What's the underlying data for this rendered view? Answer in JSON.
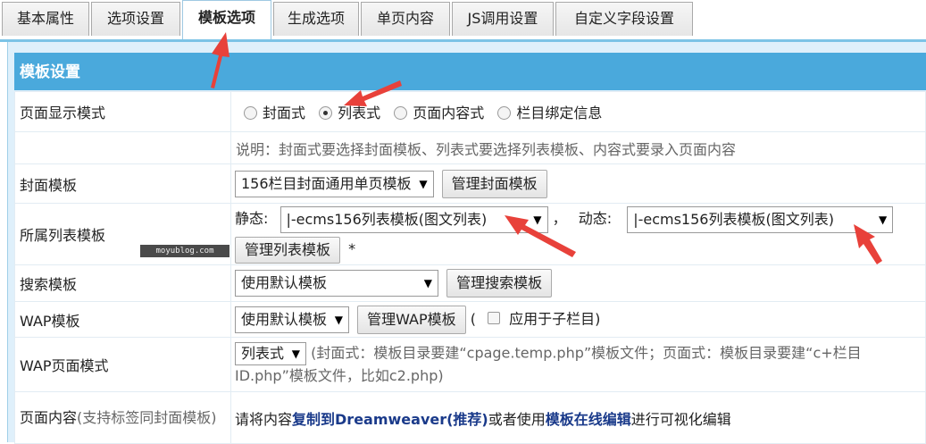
{
  "tabs": [
    "基本属性",
    "选项设置",
    "模板选项",
    "生成选项",
    "单页内容",
    "JS调用设置",
    "自定义字段设置"
  ],
  "panel_title": "模板设置",
  "display_mode": {
    "label": "页面显示模式",
    "options": [
      "封面式",
      "列表式",
      "页面内容式",
      "栏目绑定信息"
    ],
    "selected": "列表式",
    "note": "说明：封面式要选择封面模板、列表式要选择列表模板、内容式要录入页面内容"
  },
  "cover_template": {
    "label": "封面模板",
    "value": "156栏目封面通用单页模板",
    "button": "管理封面模板"
  },
  "list_template": {
    "label": "所属列表模板",
    "static_label": "静态:",
    "static_value": "|-ecms156列表模板(图文列表)",
    "separator": "，",
    "dynamic_label": "动态:",
    "dynamic_value": "|-ecms156列表模板(图文列表)",
    "button": "管理列表模板",
    "required_mark": "*"
  },
  "search_template": {
    "label": "搜索模板",
    "value": "使用默认模板",
    "button": "管理搜索模板"
  },
  "wap_template": {
    "label": "WAP模板",
    "value": "使用默认模板",
    "button": "管理WAP模板",
    "paren_open": "(",
    "checkbox_label": "应用于子栏目)"
  },
  "wap_mode": {
    "label": "WAP页面模式",
    "value": "列表式",
    "note": "(封面式：模板目录要建“cpage.temp.php”模板文件；页面式：模板目录要建“c+栏目ID.php”模板文件，比如c2.php)"
  },
  "page_content": {
    "label": "页面内容",
    "label_note": "(支持标签同封面模板)",
    "text_prefix": "请将内容",
    "link1": "复制到Dreamweaver(推荐)",
    "text_mid": "或者使用",
    "link2": "模板在线编辑",
    "text_suffix": "进行可视化编辑"
  },
  "watermark": "moyublog.com",
  "colors": {
    "accent": "#4aa9dc",
    "annotation_arrow": "#e8413a",
    "link": "#1a3a8a"
  }
}
